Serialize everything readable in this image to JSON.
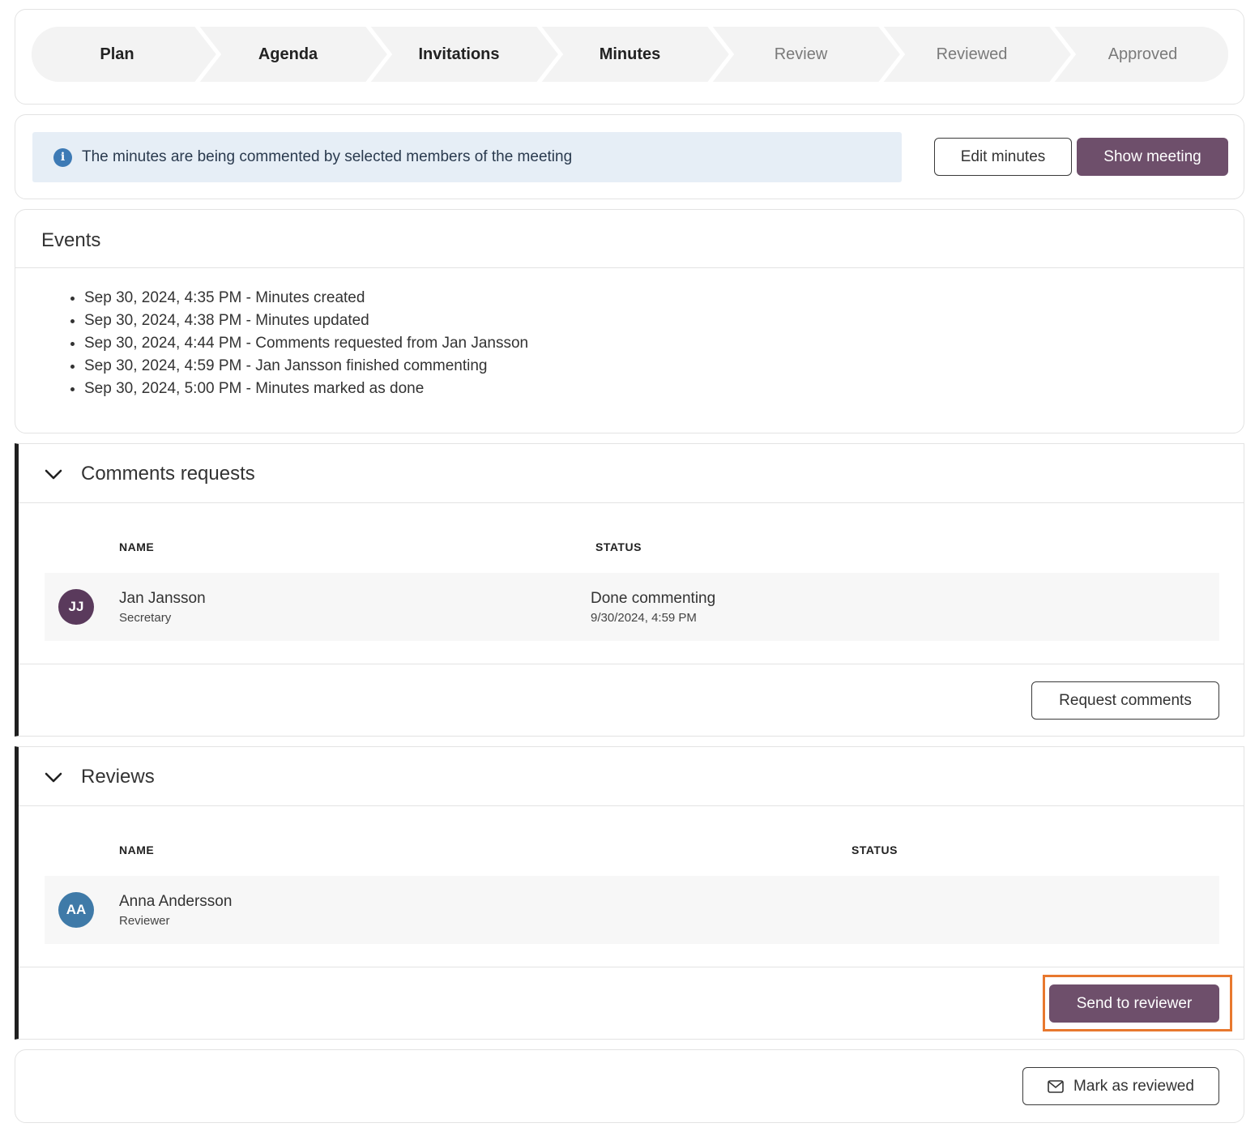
{
  "stepper": {
    "steps": [
      {
        "label": "Plan",
        "state": "done"
      },
      {
        "label": "Agenda",
        "state": "done"
      },
      {
        "label": "Invitations",
        "state": "done"
      },
      {
        "label": "Minutes",
        "state": "done"
      },
      {
        "label": "Review",
        "state": "todo"
      },
      {
        "label": "Reviewed",
        "state": "todo"
      },
      {
        "label": "Approved",
        "state": "todo"
      }
    ]
  },
  "info": {
    "icon": "info-icon",
    "message": "The minutes are being commented by selected members of the meeting",
    "edit_label": "Edit minutes",
    "show_label": "Show meeting"
  },
  "events": {
    "title": "Events",
    "items": [
      "Sep 30, 2024, 4:35 PM - Minutes created",
      "Sep 30, 2024, 4:38 PM - Minutes updated",
      "Sep 30, 2024, 4:44 PM - Comments requested from Jan Jansson",
      "Sep 30, 2024, 4:59 PM - Jan Jansson finished commenting",
      "Sep 30, 2024, 5:00 PM - Minutes marked as done"
    ]
  },
  "comments": {
    "title": "Comments requests",
    "col_name": "NAME",
    "col_status": "STATUS",
    "rows": [
      {
        "initials": "JJ",
        "name": "Jan Jansson",
        "role": "Secretary",
        "status": "Done commenting",
        "status_time": "9/30/2024, 4:59 PM",
        "avatar_color": "#5a3a5c"
      }
    ],
    "action_label": "Request comments"
  },
  "reviews": {
    "title": "Reviews",
    "col_name": "NAME",
    "col_status": "STATUS",
    "rows": [
      {
        "initials": "AA",
        "name": "Anna Andersson",
        "role": "Reviewer",
        "avatar_color": "#3f7aa8"
      }
    ],
    "action_label": "Send to reviewer"
  },
  "footer": {
    "mark_label": "Mark as reviewed",
    "mark_icon": "envelope-icon"
  },
  "colors": {
    "primary": "#6e4f6b",
    "info_bg": "#e6eef6",
    "highlight": "#e8782e"
  }
}
